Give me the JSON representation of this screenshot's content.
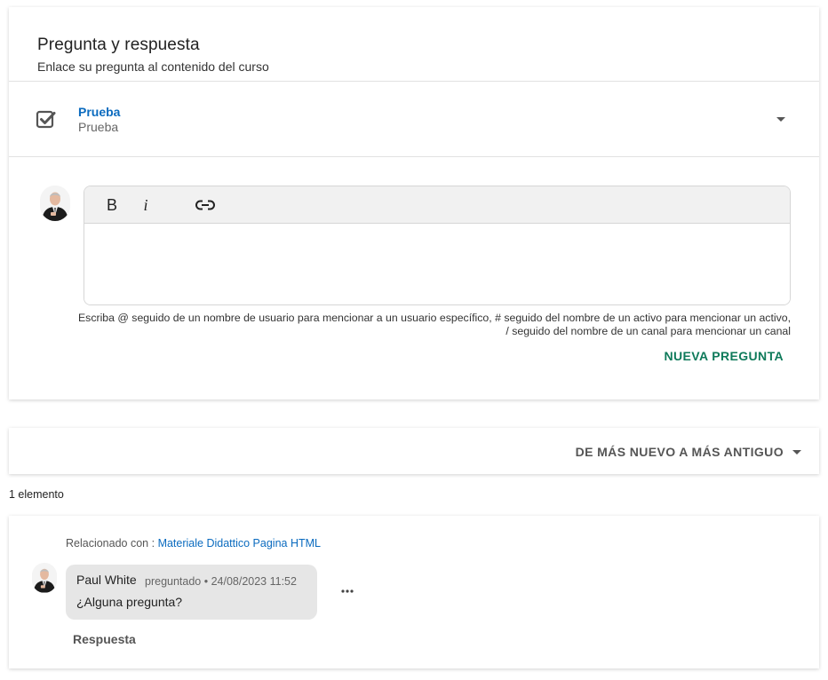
{
  "qa": {
    "title": "Pregunta y respuesta",
    "subtitle": "Enlace su pregunta al contenido del curso"
  },
  "content_selector": {
    "title": "Prueba",
    "subtitle": "Prueba",
    "checkbox_icon": "checkbox-checked-icon",
    "caret_icon": "caret-down-icon"
  },
  "editor": {
    "bold_label": "B",
    "italic_label": "i",
    "link_icon": "link-icon",
    "value": "",
    "hint_line1": "Escriba @ seguido de un nombre de usuario para mencionar a un usuario específico, # seguido del nombre de un activo para mencionar un activo,",
    "hint_line2": "/ seguido del nombre de un canal para mencionar un canal"
  },
  "new_question_label": "NUEVA PREGUNTA",
  "sort": {
    "label": "DE MÁS NUEVO A MÁS ANTIGUO"
  },
  "item_count": "1 elemento",
  "question": {
    "related_prefix": "Relacionado con :",
    "related_link": "Materiale Didattico Pagina HTML",
    "author": "Paul White",
    "meta": "preguntado • 24/08/2023 11:52",
    "text": "¿Alguna pregunta?",
    "reply_label": "Respuesta",
    "more_icon": "more-horizontal-icon"
  },
  "colors": {
    "link_blue": "#0b6bbf",
    "action_green": "#0e7a5a",
    "bubble_gray": "#e6e6e6"
  }
}
